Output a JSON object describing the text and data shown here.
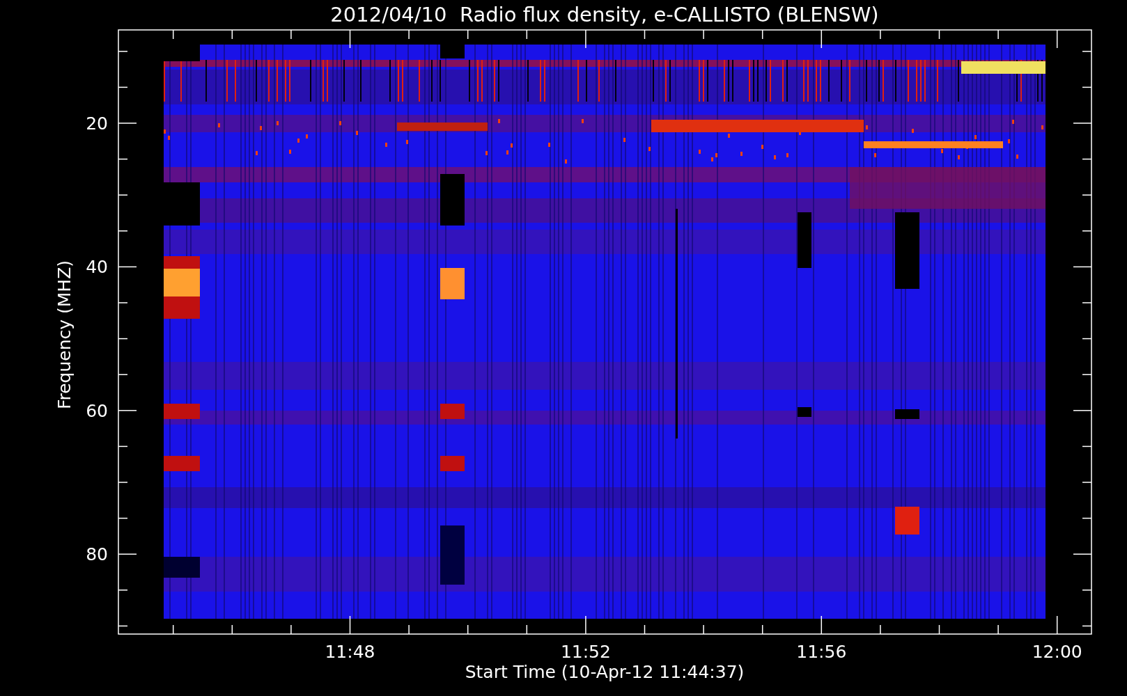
{
  "plot": {
    "title": "2012/04/10  Radio flux density, e-CALLISTO (BLENSW)",
    "ylabel": "Frequency (MHZ)",
    "xlabel": "Start Time (10-Apr-12 11:44:37)",
    "yticks": [
      "20",
      "40",
      "60",
      "80"
    ],
    "xticks": [
      "11:48",
      "11:52",
      "11:56",
      "12:00"
    ]
  }
}
